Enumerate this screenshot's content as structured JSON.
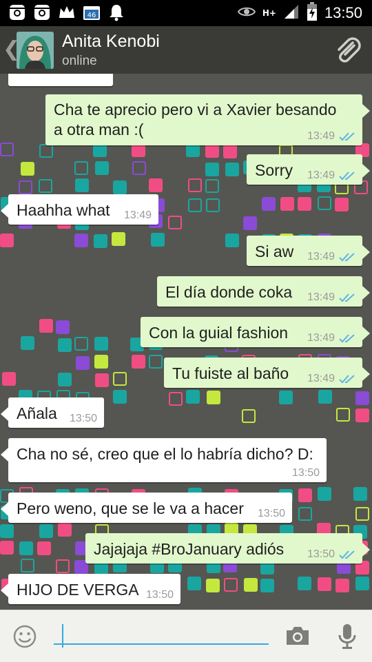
{
  "status_bar": {
    "time": "13:50",
    "network_label": "H+"
  },
  "header": {
    "name": "Anita Kenobi",
    "status": "online"
  },
  "messages": [
    {
      "side": "out",
      "text": "Cha te aprecio pero vi a Xavier besando",
      "text2": "a otra man :(",
      "time": "13:49"
    },
    {
      "side": "out",
      "text": "Sorry",
      "time": "13:49"
    },
    {
      "side": "in",
      "text": "Haahha what",
      "time": "13:49"
    },
    {
      "side": "out",
      "text": "Si aw",
      "time": "13:49"
    },
    {
      "side": "out",
      "text": "El día donde coka",
      "time": "13:49"
    },
    {
      "side": "out",
      "text": "Con la guial fashion",
      "time": "13:49"
    },
    {
      "side": "out",
      "text": "Tu fuiste al baño",
      "time": "13:49"
    },
    {
      "side": "in",
      "text": "Añala",
      "time": "13:50"
    },
    {
      "side": "in",
      "text": "Cha no sé, creo que el lo habría dicho? D:",
      "time": "13:50"
    },
    {
      "side": "in",
      "text": "Pero weno, que se le va a hacer",
      "time": "13:50"
    },
    {
      "side": "out",
      "text": "Jajajaja #BroJanuary adiós",
      "time": "13:50"
    },
    {
      "side": "in",
      "text": "HIJO DE VERGA",
      "time": "13:50"
    }
  ],
  "input": {
    "placeholder": ""
  },
  "colors": {
    "accent": "#33aadd",
    "outgoing_bubble": "#e1f8cc",
    "incoming_bubble": "#ffffff",
    "tick": "#5bb4e5",
    "chat_bg": "#555651"
  }
}
